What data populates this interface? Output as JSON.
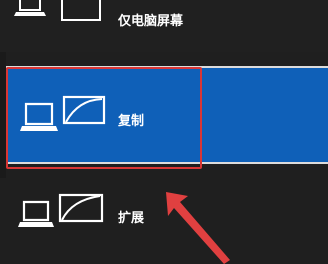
{
  "menu": {
    "items": [
      {
        "label": "仅电脑屏幕",
        "icon": "pc-screen-only-icon",
        "selected": false
      },
      {
        "label": "复制",
        "icon": "duplicate-icon",
        "selected": true
      },
      {
        "label": "扩展",
        "icon": "extend-icon",
        "selected": false
      }
    ]
  },
  "colors": {
    "background": "#1f1f1f",
    "selected": "#0f60b8",
    "highlight_border": "#d93636",
    "arrow": "#e04040",
    "text": "#ffffff"
  }
}
